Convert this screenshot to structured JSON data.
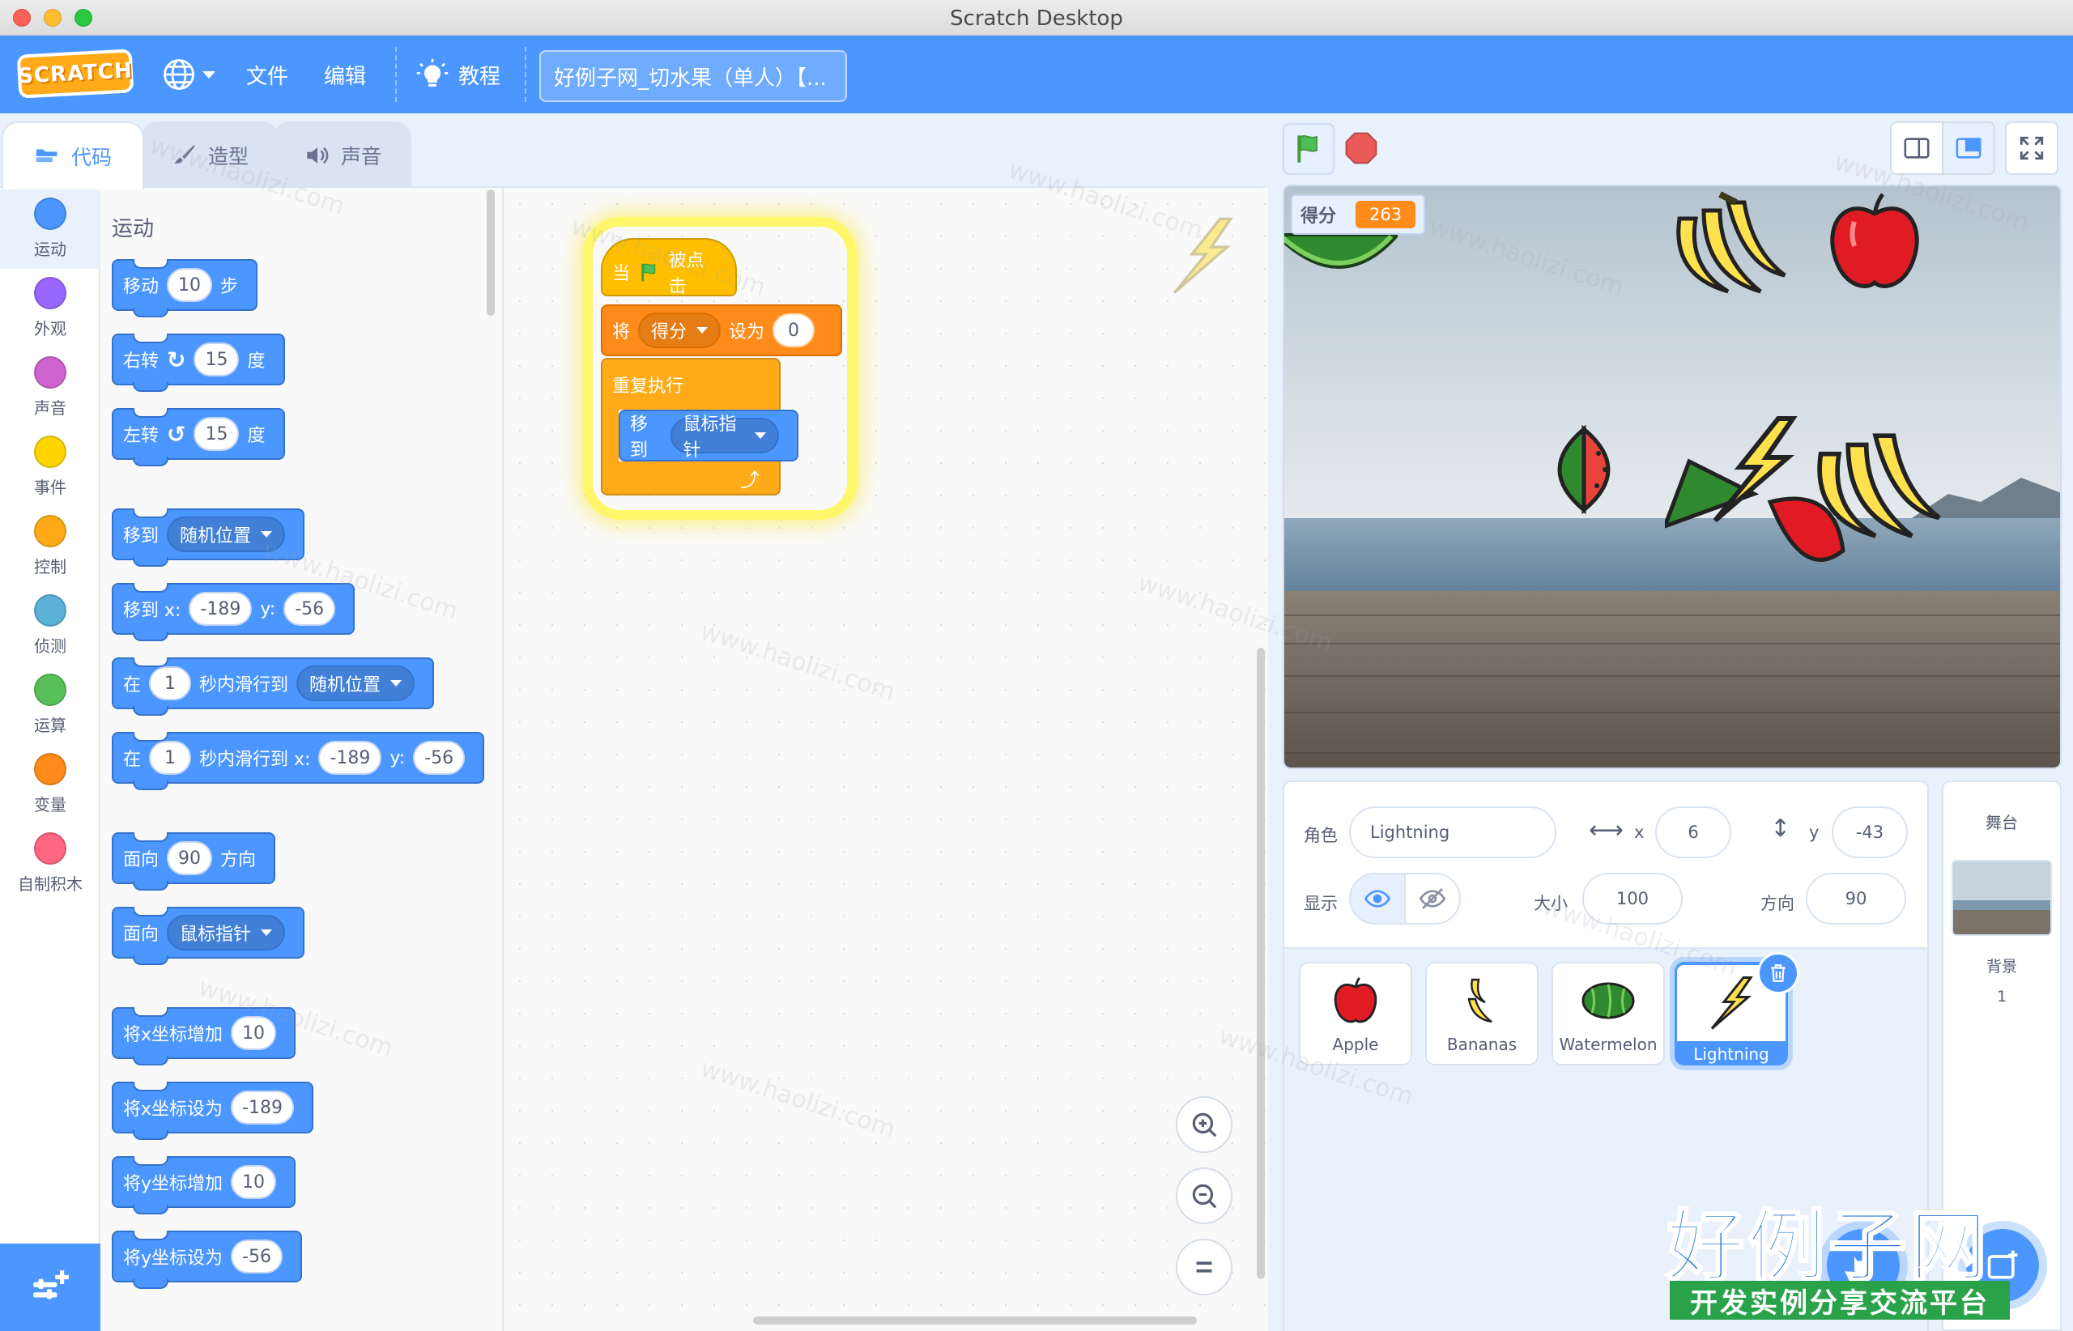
{
  "window": {
    "title": "Scratch Desktop"
  },
  "menubar": {
    "logo_text": "SCRATCH",
    "file": "文件",
    "edit": "编辑",
    "tutorials": "教程",
    "project_title": "好例子网_切水果（单人）【..."
  },
  "tabs": {
    "code": "代码",
    "costumes": "造型",
    "sounds": "声音"
  },
  "categories": [
    {
      "label": "运动",
      "color": "#4c97ff"
    },
    {
      "label": "外观",
      "color": "#9966ff"
    },
    {
      "label": "声音",
      "color": "#cf63cf"
    },
    {
      "label": "事件",
      "color": "#ffd500"
    },
    {
      "label": "控制",
      "color": "#ffab19"
    },
    {
      "label": "侦测",
      "color": "#5cb1d6"
    },
    {
      "label": "运算",
      "color": "#59c059"
    },
    {
      "label": "变量",
      "color": "#ff8c1a"
    },
    {
      "label": "自制积木",
      "color": "#ff6680"
    }
  ],
  "palette": {
    "section": "运动",
    "move": {
      "label": "移动",
      "steps": "10",
      "unit": "步"
    },
    "turn_right": {
      "label": "右转",
      "degrees": "15",
      "unit": "度"
    },
    "turn_left": {
      "label": "左转",
      "degrees": "15",
      "unit": "度"
    },
    "goto": {
      "label": "移到",
      "target": "随机位置"
    },
    "goto_xy": {
      "label": "移到 x:",
      "x": "-189",
      "ylabel": "y:",
      "y": "-56"
    },
    "glide": {
      "label_in": "在",
      "secs": "1",
      "label": "秒内滑行到",
      "target": "随机位置"
    },
    "glide_xy": {
      "label_in": "在",
      "secs": "1",
      "label": "秒内滑行到 x:",
      "x": "-189",
      "ylabel": "y:",
      "y": "-56"
    },
    "point_dir": {
      "label": "面向",
      "dir": "90",
      "unit": "方向"
    },
    "point_towards": {
      "label": "面向",
      "target": "鼠标指针"
    },
    "change_x": {
      "label": "将x坐标增加",
      "value": "10"
    },
    "set_x": {
      "label": "将x坐标设为",
      "value": "-189"
    },
    "change_y": {
      "label": "将y坐标增加",
      "value": "10"
    },
    "set_y": {
      "label": "将y坐标设为",
      "value": "-56"
    }
  },
  "script": {
    "hat_when": "当",
    "hat_clicked": "被点击",
    "set_label": "将",
    "set_var": "得分",
    "set_to": "设为",
    "set_value": "0",
    "forever": "重复执行",
    "goto_label": "移到",
    "goto_target": "鼠标指针"
  },
  "stage": {
    "monitor_label": "得分",
    "monitor_value": "263"
  },
  "sprite_info": {
    "sprite_label": "角色",
    "sprite_name": "Lightning",
    "x_label": "x",
    "x_value": "6",
    "y_label": "y",
    "y_value": "-43",
    "show_label": "显示",
    "size_label": "大小",
    "size_value": "100",
    "direction_label": "方向",
    "direction_value": "90"
  },
  "sprites": [
    {
      "name": "Apple"
    },
    {
      "name": "Bananas"
    },
    {
      "name": "Watermelon"
    },
    {
      "name": "Lightning"
    }
  ],
  "stage_target": {
    "title": "舞台",
    "backdrops_label": "背景",
    "backdrops_count": "1"
  },
  "watermark": {
    "url": "www.haolizi.com",
    "brand": "好例子网",
    "slogan": "开发实例分享交流平台"
  },
  "colors": {
    "menubar": "#4c97ff",
    "motion": "#4c97ff",
    "events": "#ffbf00",
    "control": "#ffab19",
    "variables": "#ff8c1a"
  }
}
